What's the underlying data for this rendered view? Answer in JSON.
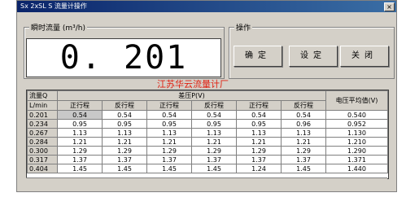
{
  "window": {
    "title": "Sx 2xSL S 流量计操作",
    "close_glyph": "×"
  },
  "flow": {
    "label": "瞬时流量 (m³/h)",
    "value": "0. 201"
  },
  "ops": {
    "label": "操作",
    "buttons": [
      "确定",
      "设定",
      "关闭"
    ]
  },
  "company": "江苏华云流量计厂",
  "table": {
    "corner_top": "流量Q",
    "corner_bottom": "L/min",
    "group_header": "差压P(V)",
    "last_header": "电压平均值(V)",
    "col_headers": [
      "正行程",
      "反行程",
      "正行程",
      "反行程",
      "正行程",
      "反行程"
    ],
    "rows": [
      {
        "flow": "0.201",
        "values": [
          "0.54",
          "0.54",
          "0.54",
          "0.54",
          "0.54",
          "0.54",
          "0.540"
        ]
      },
      {
        "flow": "0.234",
        "values": [
          "0.95",
          "0.95",
          "0.95",
          "0.95",
          "0.95",
          "0.96",
          "0.952"
        ]
      },
      {
        "flow": "0.267",
        "values": [
          "1.13",
          "1.13",
          "1.13",
          "1.13",
          "1.13",
          "1.13",
          "1.130"
        ]
      },
      {
        "flow": "0.284",
        "values": [
          "1.21",
          "1.21",
          "1.21",
          "1.21",
          "1.21",
          "1.21",
          "1.210"
        ]
      },
      {
        "flow": "0.300",
        "values": [
          "1.29",
          "1.29",
          "1.29",
          "1.29",
          "1.29",
          "1.29",
          "1.290"
        ]
      },
      {
        "flow": "0.317",
        "values": [
          "1.37",
          "1.37",
          "1.37",
          "1.37",
          "1.37",
          "1.37",
          "1.371"
        ]
      },
      {
        "flow": "0.404",
        "values": [
          "1.45",
          "1.45",
          "1.45",
          "1.45",
          "1.24",
          "1.45",
          "1.440"
        ]
      }
    ]
  }
}
